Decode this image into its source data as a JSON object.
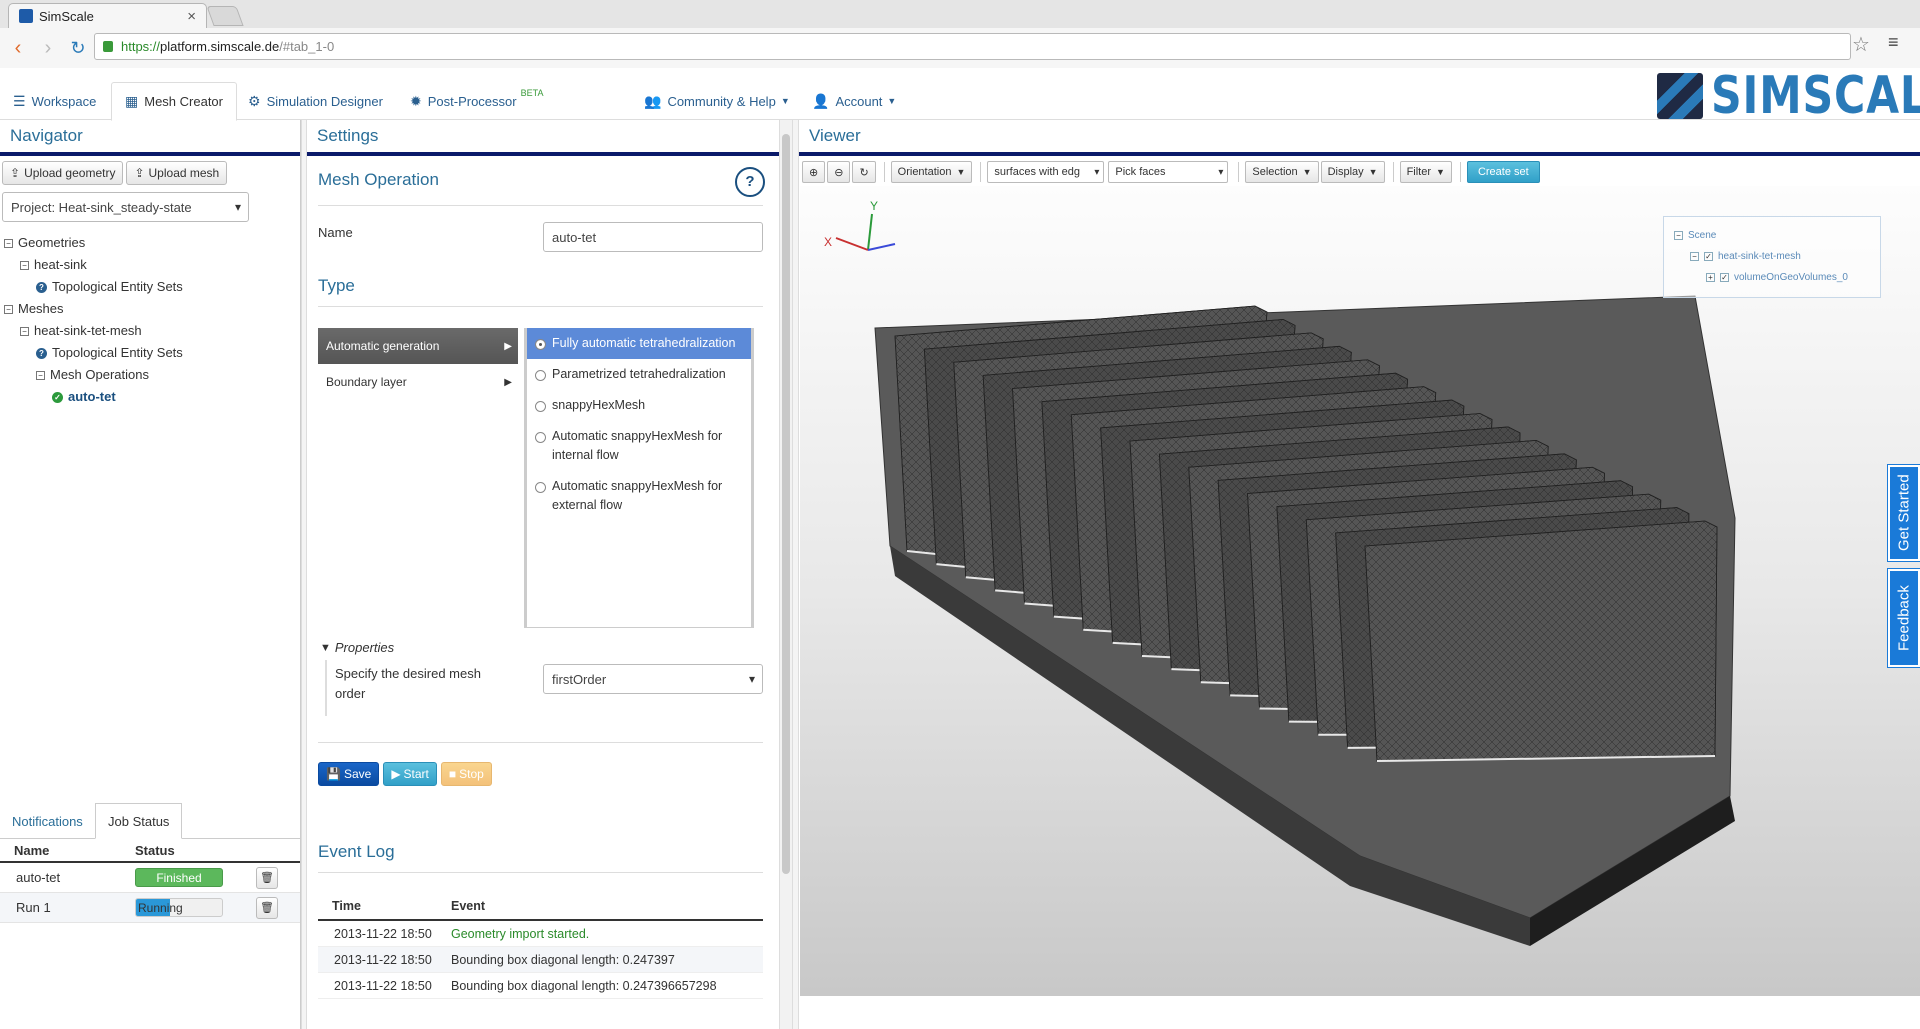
{
  "browser": {
    "tab_title": "SimScale",
    "url_scheme": "https://",
    "url_host": "platform.simscale.de",
    "url_path": "/#tab_1-0"
  },
  "appnav": {
    "tabs": [
      {
        "label": "Workspace",
        "icon": "workspace-icon"
      },
      {
        "label": "Mesh Creator",
        "icon": "grid-icon"
      },
      {
        "label": "Simulation Designer",
        "icon": "gears-icon"
      },
      {
        "label": "Post-Processor",
        "icon": "gear-icon",
        "badge": "BETA"
      }
    ],
    "community_label": "Community & Help",
    "account_label": "Account",
    "logo_text": "SIMSCALE"
  },
  "navigator": {
    "title": "Navigator",
    "upload_geometry": "Upload geometry",
    "upload_mesh": "Upload mesh",
    "project_select": "Project: Heat-sink_steady-state",
    "tree": {
      "geometries": "Geometries",
      "heat_sink": "heat-sink",
      "topo_sets_1": "Topological Entity Sets",
      "meshes": "Meshes",
      "heat_sink_mesh": "heat-sink-tet-mesh",
      "topo_sets_2": "Topological Entity Sets",
      "mesh_operations": "Mesh Operations",
      "auto_tet": "auto-tet"
    }
  },
  "status": {
    "tab_notifications": "Notifications",
    "tab_job_status": "Job Status",
    "col_name": "Name",
    "col_status": "Status",
    "jobs": [
      {
        "name": "auto-tet",
        "status": "Finished"
      },
      {
        "name": "Run 1",
        "status": "Running",
        "progress": 0.4
      }
    ]
  },
  "settings": {
    "title": "Settings",
    "mesh_operation": "Mesh Operation",
    "help": "?",
    "name_label": "Name",
    "name_value": "auto-tet",
    "type_title": "Type",
    "type_nav": [
      "Automatic generation",
      "Boundary layer"
    ],
    "options": [
      "Fully automatic tetrahedralization",
      "Parametrized tetrahedralization",
      "snappyHexMesh",
      "Automatic snappyHexMesh for internal flow",
      "Automatic snappyHexMesh for external flow"
    ],
    "properties_label": "Properties",
    "mesh_order_label": "Specify the desired mesh order",
    "mesh_order_value": "firstOrder",
    "save": "Save",
    "start": "Start",
    "stop": "Stop",
    "event_log_title": "Event Log",
    "ev_col_time": "Time",
    "ev_col_event": "Event",
    "events": [
      {
        "time": "2013-11-22 18:50",
        "event": "Geometry import started."
      },
      {
        "time": "2013-11-22 18:50",
        "event": "Bounding box diagonal length: 0.247397"
      },
      {
        "time": "2013-11-22 18:50",
        "event": "Bounding box diagonal length: 0.247396657298"
      }
    ]
  },
  "viewer": {
    "title": "Viewer",
    "orientation": "Orientation",
    "render_mode": "surfaces with edg",
    "pick_mode": "Pick faces",
    "selection": "Selection",
    "display": "Display",
    "filter": "Filter",
    "create_set": "Create set",
    "scene": {
      "root": "Scene",
      "mesh": "heat-sink-tet-mesh",
      "volume": "volumeOnGeoVolumes_0"
    },
    "get_started": "Get Started",
    "feedback": "Feedback"
  }
}
